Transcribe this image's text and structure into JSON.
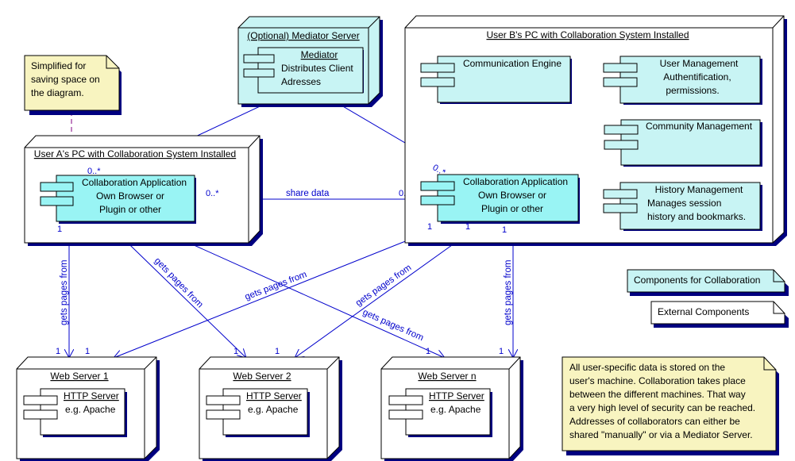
{
  "colors": {
    "component_fill": "#c8f4f4",
    "active_component_fill": "#99f4f4",
    "node_fill": "#ffffff",
    "mediator_node_fill": "#c8f4f4",
    "note_fill": "#f8f4c0",
    "shadow": "#000080",
    "edge": "#0000cc"
  },
  "nodes": {
    "mediator": {
      "title": "(Optional) Mediator Server",
      "component": {
        "name": "Mediator",
        "lines": [
          "Distributes Client",
          "Adresses"
        ]
      }
    },
    "user_a": {
      "title": "User A's PC with Collaboration System Installed",
      "component": {
        "lines": [
          "Collaboration Application",
          "Own Browser or",
          "Plugin or other"
        ]
      }
    },
    "user_b": {
      "title": "User B's PC with Collaboration System Installed",
      "collab": {
        "lines": [
          "Collaboration Application",
          "Own Browser or",
          "Plugin or other"
        ]
      },
      "comm_engine": {
        "lines": [
          "Communication Engine"
        ]
      },
      "user_mgmt": {
        "lines": [
          "User Management",
          "Authentification,",
          "permissions."
        ]
      },
      "community_mgmt": {
        "lines": [
          "Community Management"
        ]
      },
      "history_mgmt": {
        "lines": [
          "History Management",
          "Manages session",
          "history and bookmarks."
        ]
      }
    },
    "web1": {
      "title": "Web Server 1",
      "component": {
        "name": "HTTP Server",
        "lines": [
          "e.g. Apache"
        ]
      }
    },
    "web2": {
      "title": "Web Server 2",
      "component": {
        "name": "HTTP Server",
        "lines": [
          "e.g. Apache"
        ]
      }
    },
    "webn": {
      "title": "Web Server n",
      "component": {
        "name": "HTTP Server",
        "lines": [
          "e.g. Apache"
        ]
      }
    }
  },
  "notes": {
    "simplified": [
      "Simplified for",
      "saving space on",
      "the diagram."
    ],
    "legend_collab": "Components for Collaboration",
    "legend_external": "External Components",
    "info": [
      "All user-specific data is stored on the",
      "user's machine. Collaboration takes place",
      "between the different machines. That way",
      "a very high level of security can be reached.",
      "Addresses of collaborators can either be",
      "shared \"manually\" or via a Mediator Server."
    ]
  },
  "edges": {
    "share_data": "share data",
    "gets_pages_from": "gets pages from",
    "mult_many": "0..*",
    "mult_one": "1"
  }
}
